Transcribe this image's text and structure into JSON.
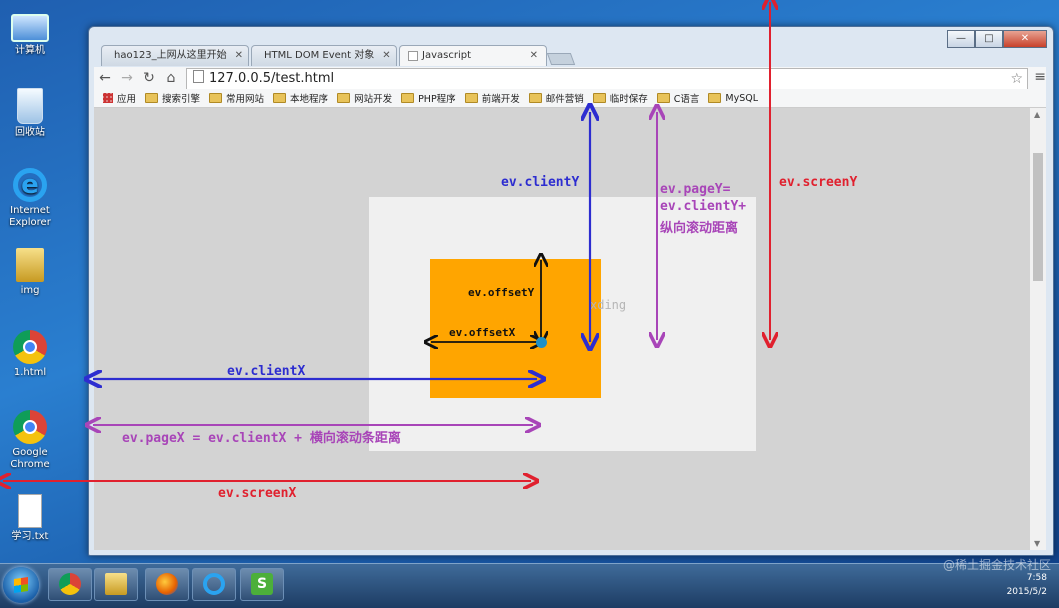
{
  "desktop": {
    "icons": [
      {
        "label": "计算机",
        "icon": "computer-icon"
      },
      {
        "label": "回收站",
        "icon": "recycle-bin-icon"
      },
      {
        "label": "Internet Explorer",
        "icon": "ie-icon"
      },
      {
        "label": "img",
        "icon": "folder-icon"
      },
      {
        "label": "1.html",
        "icon": "chrome-icon"
      },
      {
        "label": "Google Chrome",
        "icon": "chrome-icon"
      },
      {
        "label": "学习.txt",
        "icon": "text-file-icon"
      }
    ]
  },
  "browser": {
    "tabs": [
      {
        "label": "hao123_上网从这里开始",
        "active": false
      },
      {
        "label": "HTML DOM Event 对象",
        "active": false
      },
      {
        "label": "Javascript",
        "active": true
      }
    ],
    "window_controls": {
      "minimize": "—",
      "maximize": "□",
      "close": "✕"
    },
    "url": "127.0.0.5/test.html",
    "bookmarks": [
      "应用",
      "搜索引擎",
      "常用网站",
      "本地程序",
      "网站开发",
      "PHP程序",
      "前端开发",
      "邮件营销",
      "临时保存",
      "C语言",
      "MySQL"
    ]
  },
  "diagram": {
    "labels": {
      "client_y": "ev.clientY",
      "page_y_1": "ev.pageY=",
      "page_y_2": "ev.clientY+",
      "page_y_3": "纵向滚动距离",
      "screen_y": "ev.screenY",
      "offset_y": "ev.offsetY",
      "offset_x": "ev.offsetX",
      "client_x": "ev.clientX",
      "page_x": "ev.pageX = ev.clientX + 横向滚动条距离",
      "screen_x": "ev.screenX"
    },
    "watermark": "xding",
    "colors": {
      "blue": "#2d2dd0",
      "purple": "#a845b8",
      "red": "#e0202e",
      "black": "#111111",
      "box": "#ffa500",
      "dot": "#1e90c8"
    }
  },
  "taskbar": {
    "apps": [
      "chrome-icon",
      "explorer-icon",
      "firefox-icon",
      "ie-icon",
      "app-s-icon"
    ],
    "clock_time": "7:58",
    "clock_date": "2015/5/2",
    "watermark": "@稀土掘金技术社区"
  }
}
